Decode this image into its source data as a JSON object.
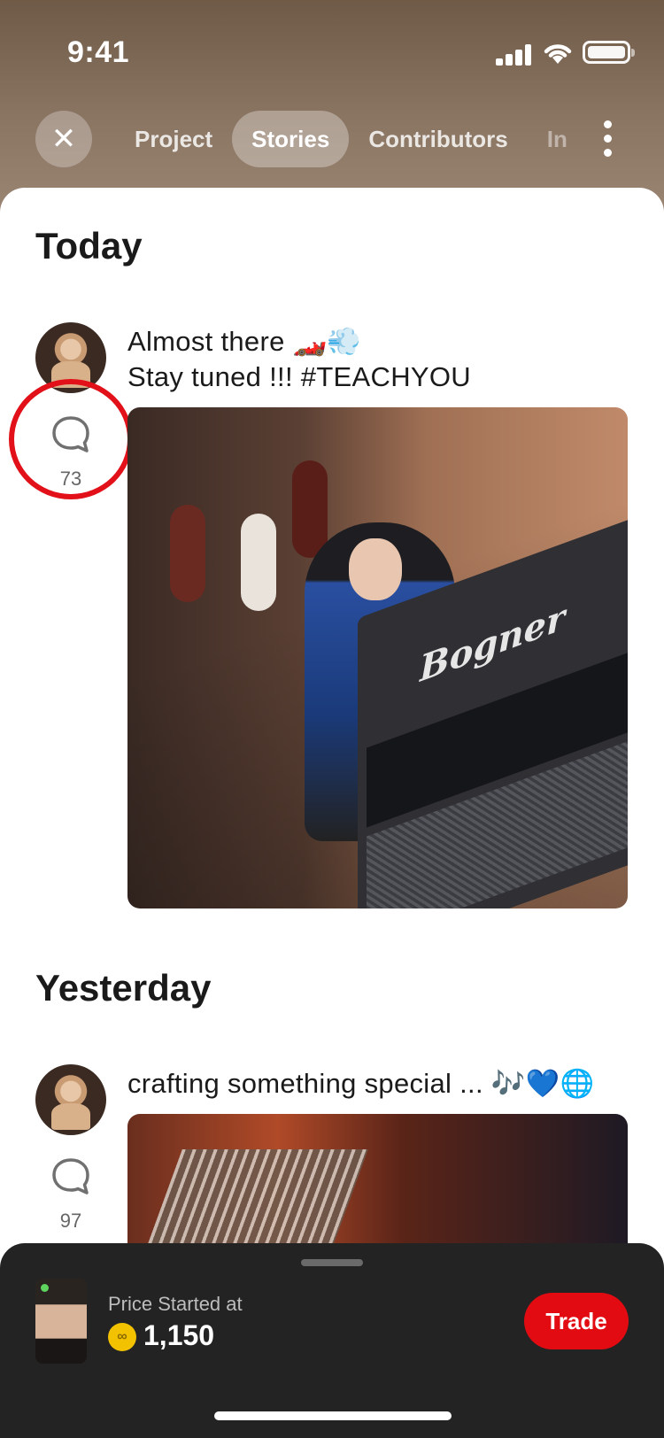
{
  "status_bar": {
    "time": "9:41"
  },
  "nav": {
    "tabs": [
      {
        "label": "Project"
      },
      {
        "label": "Stories"
      },
      {
        "label": "Contributors"
      },
      {
        "label": "In"
      }
    ]
  },
  "sections": [
    {
      "title": "Today",
      "post": {
        "text_line1": "Almost there 🏎️💨",
        "text_line2": "Stay tuned !!! #TEACHYOU",
        "comment_count": "73",
        "image_brand_text": "Bogner"
      }
    },
    {
      "title": "Yesterday",
      "post": {
        "text_line1": "crafting something special ... 🎶💙🌐",
        "comment_count": "97"
      }
    }
  ],
  "bottom_sheet": {
    "price_label": "Price Started at",
    "coin_symbol": "∞",
    "price_value": "1,150",
    "trade_label": "Trade"
  },
  "colors": {
    "accent": "#e20b12",
    "highlight": "#e21018",
    "coin": "#f2c200",
    "sheet": "#232323"
  },
  "icons": {
    "close": "close-icon",
    "more": "more-vertical-icon",
    "comment": "comment-bubble-icon",
    "coin": "coin-icon"
  }
}
